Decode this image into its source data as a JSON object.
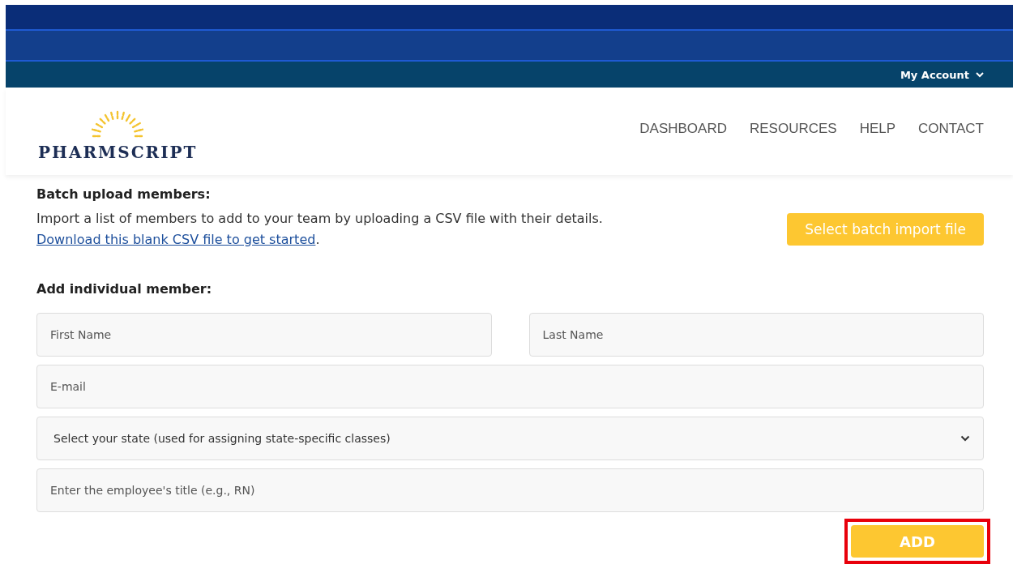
{
  "top_bar": {
    "account_menu": "My Account"
  },
  "header": {
    "logo_text": "PHARMSCRIPT",
    "nav": [
      {
        "label": "DASHBOARD"
      },
      {
        "label": "RESOURCES"
      },
      {
        "label": "HELP"
      },
      {
        "label": "CONTACT"
      }
    ]
  },
  "batch": {
    "heading": "Batch upload members:",
    "description": "Import a list of members to add to your team by uploading a CSV file with their details.",
    "link": "Download this blank CSV file to get started",
    "link_suffix": ".",
    "button": "Select batch import file"
  },
  "individual": {
    "heading": "Add individual member:",
    "first_name": {
      "placeholder": "First Name"
    },
    "last_name": {
      "placeholder": "Last Name"
    },
    "email": {
      "placeholder": "E-mail"
    },
    "state": {
      "placeholder": "Select your state (used for assigning state-specific classes)"
    },
    "title": {
      "placeholder": "Enter the employee's title (e.g., RN)"
    },
    "add_button": {
      "label": "ADD",
      "highlighted": true
    }
  }
}
